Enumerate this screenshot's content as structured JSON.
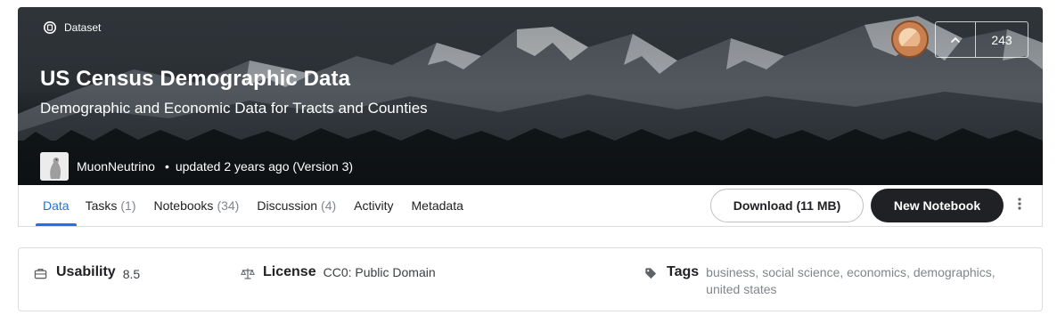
{
  "banner": {
    "type_label": "Dataset",
    "title": "US Census Demographic Data",
    "subtitle": "Demographic and Economic Data for Tracts and Counties",
    "author": "MuonNeutrino",
    "dot": "•",
    "updated": "updated 2 years ago (Version 3)",
    "vote_count": "243"
  },
  "tabs": [
    {
      "label": "Data",
      "count": "",
      "active": true
    },
    {
      "label": "Tasks",
      "count": "(1)",
      "active": false
    },
    {
      "label": "Notebooks",
      "count": "(34)",
      "active": false
    },
    {
      "label": "Discussion",
      "count": "(4)",
      "active": false
    },
    {
      "label": "Activity",
      "count": "",
      "active": false
    },
    {
      "label": "Metadata",
      "count": "",
      "active": false
    }
  ],
  "actions": {
    "download_label": "Download (11 MB)",
    "new_notebook_label": "New Notebook"
  },
  "info": {
    "usability_label": "Usability",
    "usability_value": "8.5",
    "license_label": "License",
    "license_value": "CC0: Public Domain",
    "tags_label": "Tags",
    "tags": [
      "business",
      "social science",
      "economics",
      "demographics",
      "united states"
    ]
  },
  "colors": {
    "accent": "#1a73e8",
    "dark_button": "#202124",
    "muted_text": "#80868b"
  },
  "icons": {
    "type": "dataset-icon",
    "vote": "chevron-up-icon",
    "menu": "more-vert-icon",
    "usability": "briefcase-icon",
    "license": "scale-icon",
    "tags": "tag-icon"
  }
}
